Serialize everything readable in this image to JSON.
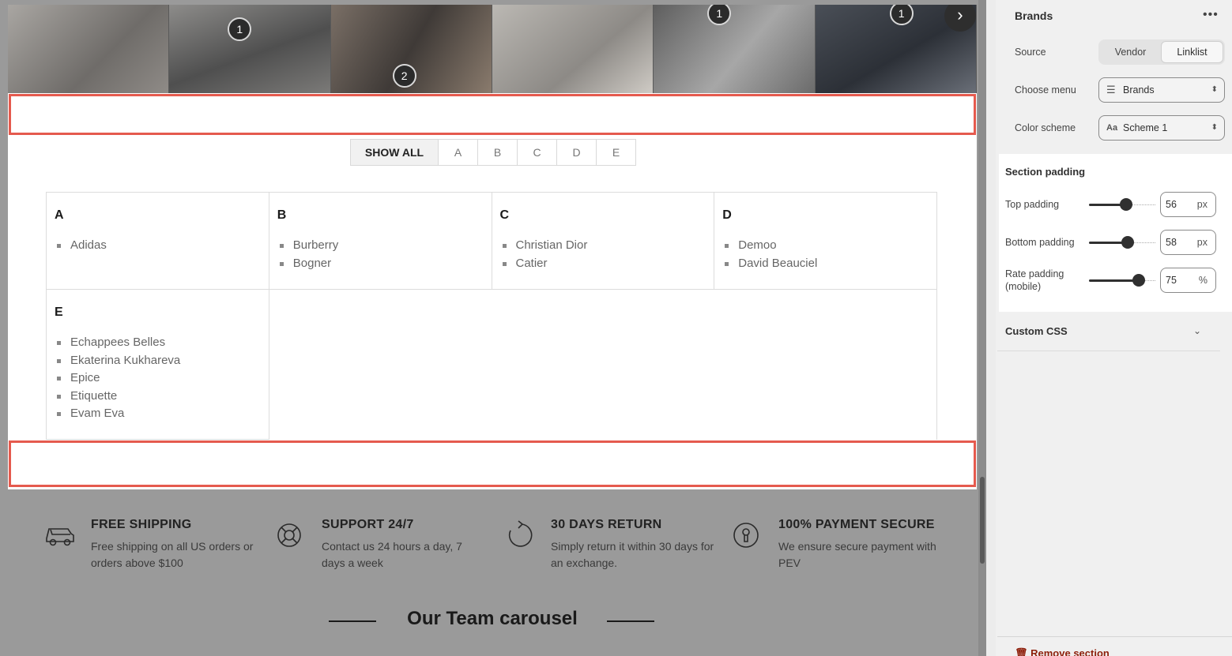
{
  "instagram": {
    "pins": [
      "1",
      "2",
      "1",
      "1"
    ],
    "next_icon": "chevron-right-icon"
  },
  "filter": [
    "SHOW ALL",
    "A",
    "B",
    "C",
    "D",
    "E"
  ],
  "brands": [
    {
      "letter": "A",
      "items": [
        "Adidas"
      ]
    },
    {
      "letter": "B",
      "items": [
        "Burberry",
        "Bogner"
      ]
    },
    {
      "letter": "C",
      "items": [
        "Christian Dior",
        "Catier"
      ]
    },
    {
      "letter": "D",
      "items": [
        "Demoo",
        "David Beauciel"
      ]
    },
    {
      "letter": "E",
      "items": [
        "Echappees Belles",
        "Ekaterina Kukhareva",
        "Epice",
        "Etiquette",
        "Evam Eva"
      ]
    }
  ],
  "features": [
    {
      "icon": "truck-icon",
      "title": "FREE SHIPPING",
      "text": "Free shipping on all US orders or orders above $100"
    },
    {
      "icon": "lifebuoy-icon",
      "title": "SUPPORT 24/7",
      "text": "Contact us 24 hours a day, 7 days a week"
    },
    {
      "icon": "return-icon",
      "title": "30 DAYS RETURN",
      "text": "Simply return it within 30 days for an exchange."
    },
    {
      "icon": "secure-lock-icon",
      "title": "100% PAYMENT SECURE",
      "text": "We ensure secure payment with PEV"
    }
  ],
  "team": {
    "title": "Our Team carousel"
  },
  "panel": {
    "title": "Brands",
    "more_icon": "more-horizontal-icon",
    "source_label": "Source",
    "source_options": [
      "Vendor",
      "Linklist"
    ],
    "source_selected": "Linklist",
    "menu_label": "Choose menu",
    "menu_value": "Brands",
    "scheme_label": "Color scheme",
    "scheme_value": "Scheme 1",
    "padding": {
      "title": "Section padding",
      "top_label": "Top padding",
      "top_value": "56",
      "top_unit": "px",
      "top_fraction": 0.56,
      "bottom_label": "Bottom padding",
      "bottom_value": "58",
      "bottom_unit": "px",
      "bottom_fraction": 0.58,
      "rate_label_1": "Rate padding",
      "rate_label_2": "(mobile)",
      "rate_value": "75",
      "rate_unit": "%",
      "rate_fraction": 0.75
    },
    "custom_css": "Custom CSS",
    "remove": "Remove section"
  },
  "colors": {
    "highlight": "#e55a4e",
    "remove": "#8e1f0b"
  }
}
